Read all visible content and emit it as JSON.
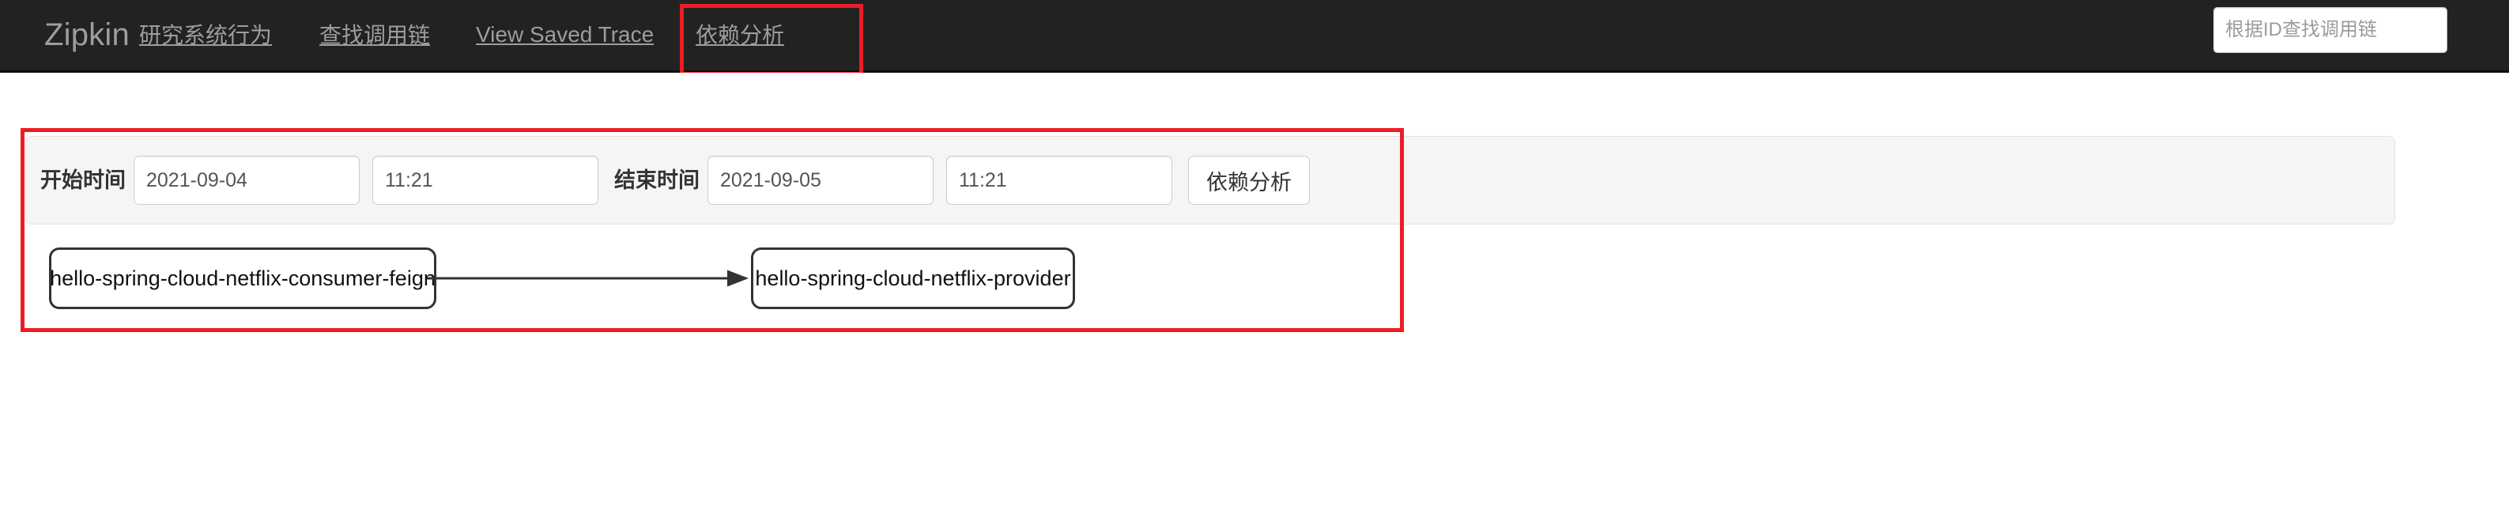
{
  "navbar": {
    "brand": "Zipkin",
    "background_color": "#222222",
    "text_color": "#9d9d9d",
    "links": [
      {
        "label": "研究系统行为",
        "active": false
      },
      {
        "label": "查找调用链",
        "active": false
      },
      {
        "label": "View Saved Trace",
        "active": false
      },
      {
        "label": "依赖分析",
        "active": true
      }
    ],
    "search": {
      "value": "",
      "placeholder": "根据ID查找调用链"
    }
  },
  "annotations": {
    "color": "#ee1c25",
    "nav_tab_box": "依赖分析",
    "content_box": "dependency-analysis-result"
  },
  "form": {
    "start_label": "开始时间",
    "start_date": "2021-09-04",
    "start_time": "11:21",
    "end_label": "结束时间",
    "end_date": "2021-09-05",
    "end_time": "11:21",
    "submit_label": "依赖分析",
    "date_placeholder": "yyyy-mm-dd",
    "time_placeholder": "--:--"
  },
  "graph": {
    "nodes": [
      {
        "id": "consumer",
        "label": "hello-spring-cloud-netflix-consumer-feign"
      },
      {
        "id": "provider",
        "label": "hello-spring-cloud-netflix-provider"
      }
    ],
    "edges": [
      {
        "from": "consumer",
        "to": "provider",
        "direction": "right"
      }
    ]
  }
}
